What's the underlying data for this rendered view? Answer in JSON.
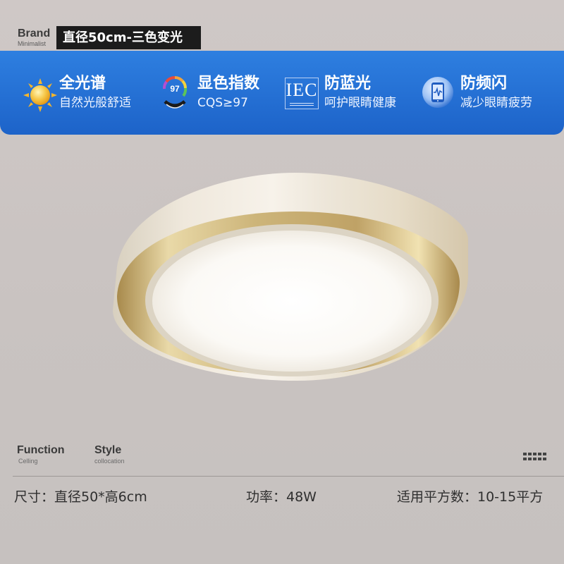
{
  "brand": {
    "name": "Brand",
    "tagline": "Minimalist"
  },
  "title": "直径50cm-三色变光",
  "features": [
    {
      "icon": "sun-icon",
      "title": "全光谱",
      "subtitle": "自然光般舒适"
    },
    {
      "icon": "color-index-gauge-icon",
      "badge": "97",
      "title": "显色指数",
      "subtitle": "CQS≥97"
    },
    {
      "icon": "iec-certification-icon",
      "badge": "IEC",
      "title": "防蓝光",
      "subtitle": "呵护眼睛健康"
    },
    {
      "icon": "anti-flicker-phone-icon",
      "title": "防频闪",
      "subtitle": "减少眼睛疲劳"
    }
  ],
  "tabs": [
    {
      "title": "Function",
      "subtitle": "Celling"
    },
    {
      "title": "Style",
      "subtitle": "collocation"
    }
  ],
  "menu_icon": "grid-dots-icon",
  "specs": {
    "size": "尺寸：直径50*高6cm",
    "power": "功率：48W",
    "area": "适用平方数：10-15平方"
  },
  "colors": {
    "banner": "#1d63c9",
    "title_bg": "#1c1c1c",
    "background": "#cbc5c3"
  }
}
